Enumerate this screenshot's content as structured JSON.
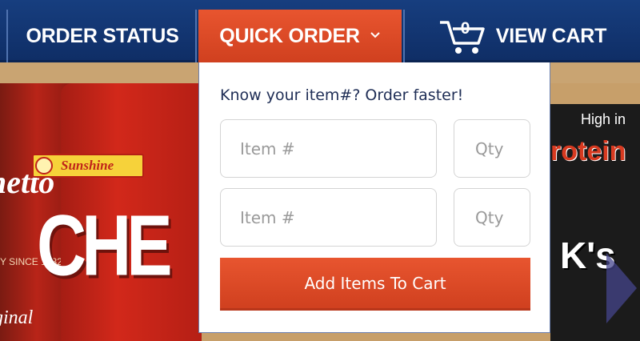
{
  "nav": {
    "order_status": "ORDER STATUS",
    "quick_order": "QUICK ORDER",
    "view_cart": "VIEW CART",
    "cart_count": "0",
    "chevron_icon": "chevron-down-icon",
    "cart_icon": "shopping-cart-icon"
  },
  "quick_order": {
    "prompt": "Know your item#? Order faster!",
    "rows": [
      {
        "item_placeholder": "Item #",
        "qty_placeholder": "Qty"
      },
      {
        "item_placeholder": "Item #",
        "qty_placeholder": "Qty"
      }
    ],
    "add_button": "Add Items To Cart"
  },
  "hero": {
    "left_package_brand": "hetto",
    "left_package_sub": "Y SINCE 1932",
    "left_package_bottom": "ginal",
    "mid_package_brand": "Sunshine",
    "mid_package_word": "CHE",
    "right_package_badge": "High in",
    "right_package_word": "rotein",
    "right_package_bottom": "K's"
  },
  "colors": {
    "nav_blue": "#173e7f",
    "accent_orange": "#e8552f",
    "prompt_text": "#1e2d55"
  }
}
